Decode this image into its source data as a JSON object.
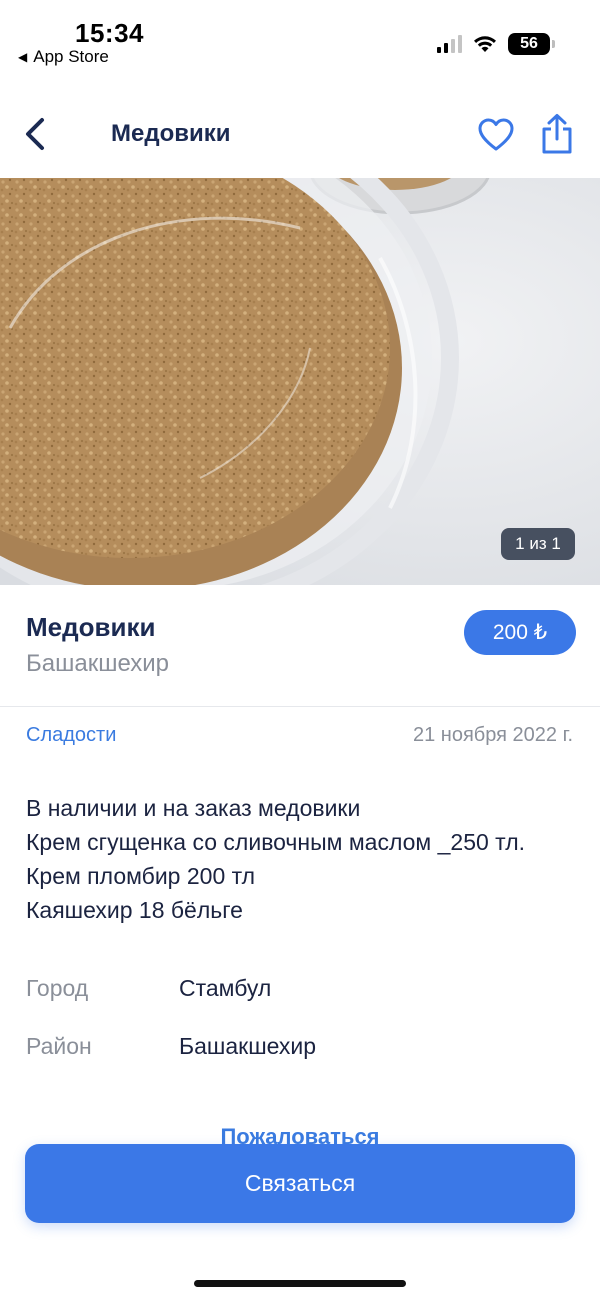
{
  "status_bar": {
    "time": "15:34",
    "back_app": "App Store",
    "battery": "56"
  },
  "header": {
    "title": "Медовики",
    "back_icon": "chevron-left-icon",
    "favorite_icon": "heart-icon",
    "share_icon": "share-icon"
  },
  "photo": {
    "counter": "1 из 1"
  },
  "ad": {
    "title": "Медовики",
    "district": "Башакшехир",
    "price": "200 ₺",
    "category": "Сладости",
    "date": "21 ноября 2022 г.",
    "description_lines": [
      "В наличии и на заказ медовики",
      "Крем сгущенка со сливочным маслом _250 тл.",
      "Крем пломбир 200 тл",
      "Каяшехир 18 бёльге"
    ],
    "attributes": [
      {
        "label": "Город",
        "value": "Стамбул"
      },
      {
        "label": "Район",
        "value": "Башакшехир"
      }
    ]
  },
  "actions": {
    "report": "Пожаловаться",
    "contact": "Связаться"
  },
  "colors": {
    "accent": "#3b78e7",
    "title": "#1b2a52",
    "muted": "#8a8f99"
  }
}
